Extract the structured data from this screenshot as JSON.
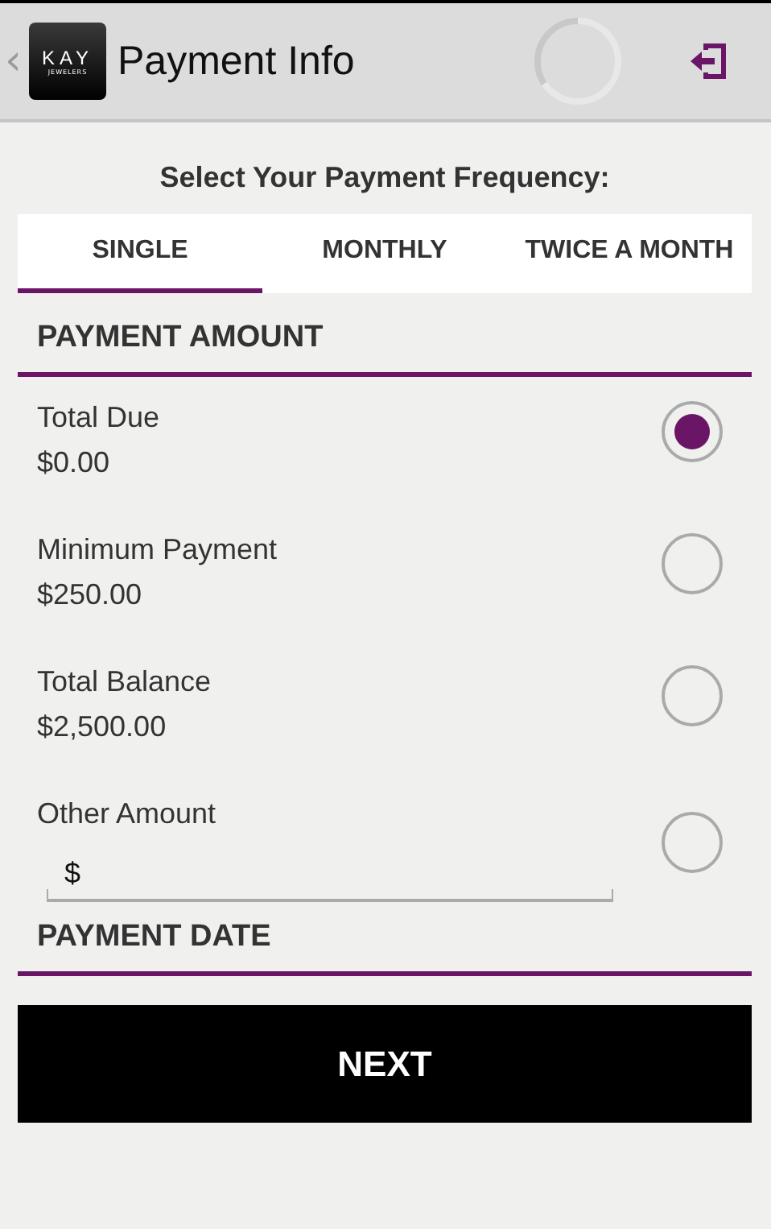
{
  "header": {
    "back": "‹",
    "logo": {
      "name": "KAY",
      "tagline": "JEWELERS"
    },
    "title": "Payment Info",
    "loading": true
  },
  "frequency": {
    "heading": "Select Your Payment Frequency:",
    "tabs": [
      {
        "label": "SINGLE",
        "selected": true
      },
      {
        "label": "MONTHLY",
        "selected": false
      },
      {
        "label": "TWICE A MONTH",
        "selected": false
      }
    ]
  },
  "payment_amount": {
    "heading": "PAYMENT AMOUNT",
    "options": [
      {
        "kind": "fixed",
        "label": "Total Due",
        "amount": "$0.00",
        "selected": true
      },
      {
        "kind": "fixed",
        "label": "Minimum Payment",
        "amount": "$250.00",
        "selected": false
      },
      {
        "kind": "fixed",
        "label": "Total Balance",
        "amount": "$2,500.00",
        "selected": false
      },
      {
        "kind": "input",
        "label": "Other Amount",
        "prefix": "$",
        "selected": false
      }
    ]
  },
  "payment_date": {
    "heading": "PAYMENT DATE"
  },
  "next_button": "NEXT"
}
